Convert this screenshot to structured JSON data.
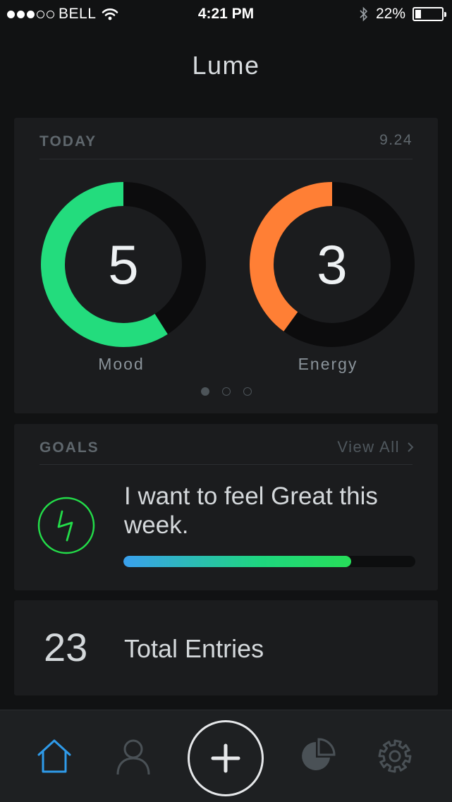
{
  "status_bar": {
    "carrier": "BELL",
    "signal_dots": [
      true,
      true,
      true,
      false,
      false
    ],
    "time": "4:21 PM",
    "battery_percent": "22%",
    "battery_level": 0.22
  },
  "app": {
    "title": "Lume"
  },
  "today": {
    "label": "TODAY",
    "date": "9.24",
    "mood": {
      "value": "5",
      "caption": "Mood",
      "fraction": 0.59,
      "color": "#23dc7d"
    },
    "energy": {
      "value": "3",
      "caption": "Energy",
      "fraction": 0.4,
      "color": "#ff7f35"
    },
    "pager": {
      "pages": 3,
      "active": 0
    }
  },
  "goals": {
    "label": "GOALS",
    "view_all": "View All",
    "goal_text": "I want to feel Great this week.",
    "progress_fraction": 0.78,
    "icon": "lightning-icon",
    "icon_color": "#23dc49"
  },
  "entries": {
    "count": "23",
    "label": "Total Entries"
  },
  "tabbar": {
    "items": [
      "home-icon",
      "profile-icon",
      "add-icon",
      "pie-chart-icon",
      "gear-icon"
    ],
    "active_color": "#2f9bea"
  }
}
